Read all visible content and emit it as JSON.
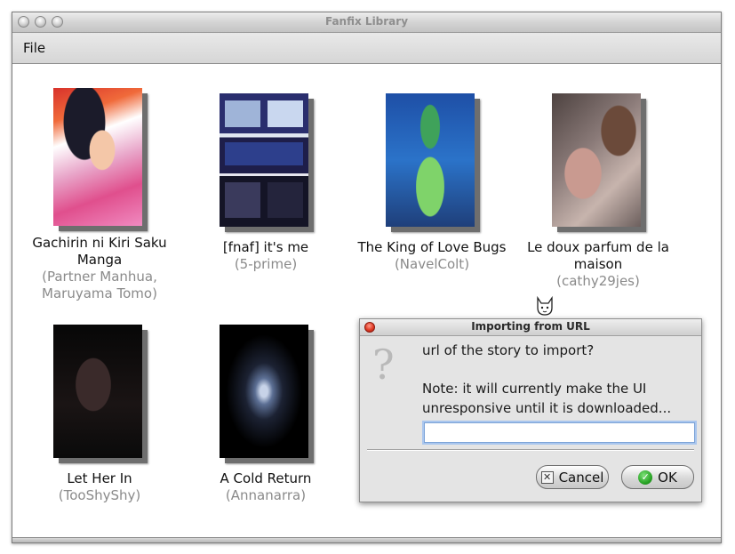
{
  "window": {
    "title": "Fanfix Library"
  },
  "menu": {
    "file": "File"
  },
  "books": [
    {
      "title_lines": [
        "Gachirin ni Kiri Saku",
        "Manga"
      ],
      "author_lines": [
        "(Partner Manhua,",
        "Maruyama Tomo)"
      ]
    },
    {
      "title_lines": [
        "[fnaf] it's me"
      ],
      "author_lines": [
        "(5-prime)"
      ]
    },
    {
      "title_lines": [
        "The King of Love Bugs"
      ],
      "author_lines": [
        "(NavelColt)"
      ]
    },
    {
      "title_lines": [
        "Le doux parfum de la",
        "maison"
      ],
      "author_lines": [
        "(cathy29jes)"
      ]
    },
    {
      "title_lines": [
        "Let Her In"
      ],
      "author_lines": [
        "(TooShyShy)"
      ]
    },
    {
      "title_lines": [
        "A Cold Return"
      ],
      "author_lines": [
        "(Annanarra)"
      ]
    }
  ],
  "dialog": {
    "title": "Importing from URL",
    "prompt": "url of the story to import?",
    "note_line1": "Note: it will currently make the UI",
    "note_line2": "unresponsive until it is downloaded...",
    "input_value": "",
    "cancel_label": "Cancel",
    "ok_label": "OK"
  },
  "icons": {
    "question": "question-icon",
    "cancel": "cancel-x-icon",
    "ok": "check-icon"
  }
}
